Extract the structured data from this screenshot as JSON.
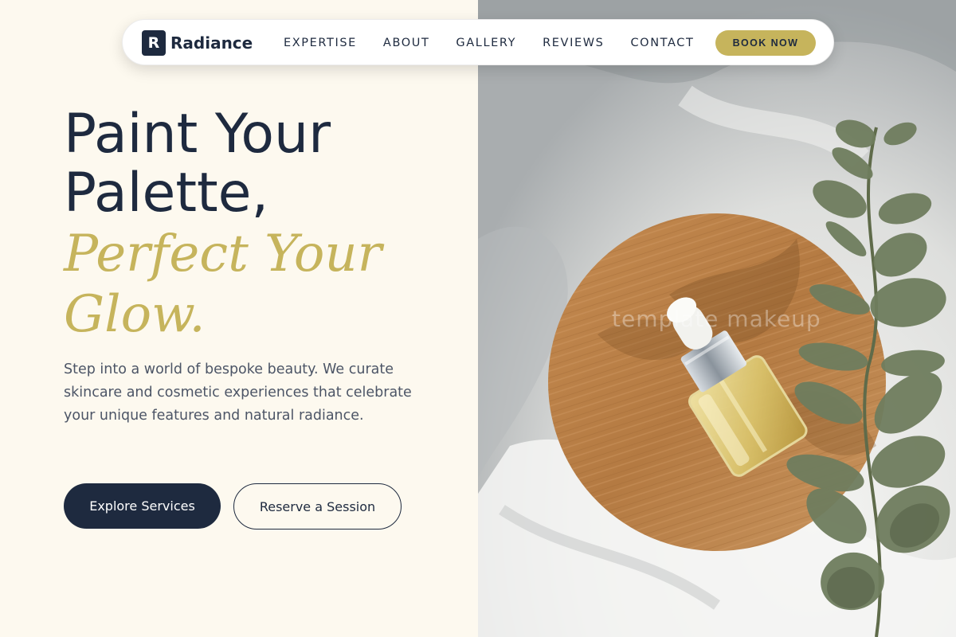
{
  "nav": {
    "brand_mark": "R",
    "brand_name": "Radiance",
    "links": [
      "EXPERTISE",
      "ABOUT",
      "GALLERY",
      "REVIEWS",
      "CONTACT"
    ],
    "cta": "BOOK NOW"
  },
  "hero": {
    "headline_line1": "Paint Your",
    "headline_line2": "Palette,",
    "headline_accent_line1": "Perfect Your",
    "headline_accent_line2": "Glow.",
    "description": "Step into a world of bespoke beauty. We curate skincare and cosmetic experiences that celebrate your unique features and natural radiance.",
    "primary_cta": "Explore Services",
    "secondary_cta": "Reserve a Session"
  },
  "photo": {
    "watermark": "template makeup",
    "subject": "serum dropper bottle on bamboo tray with eucalyptus"
  },
  "colors": {
    "navy": "#1e2a3f",
    "gold": "#c6b45c",
    "cream": "#fdf9ef"
  }
}
